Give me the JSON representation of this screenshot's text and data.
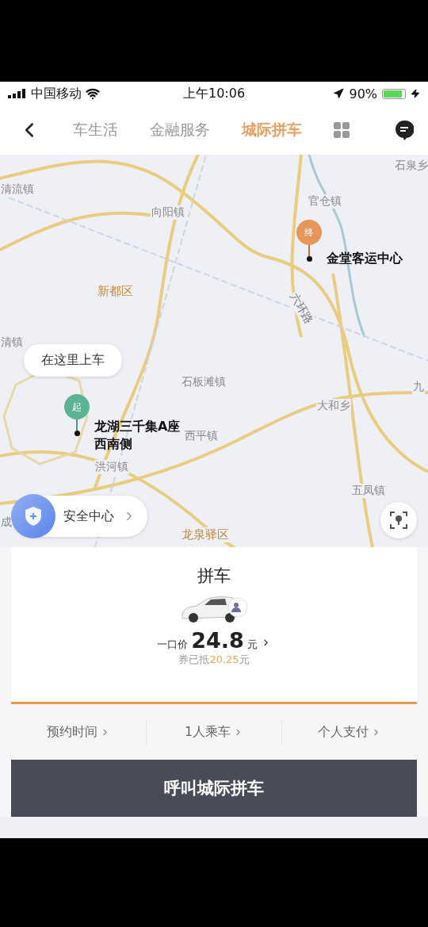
{
  "status_bar": {
    "carrier": "中国移动",
    "time": "上午10:06",
    "battery": "90%"
  },
  "nav": {
    "tabs": [
      {
        "label": "车生活",
        "selected": false
      },
      {
        "label": "金融服务",
        "selected": false
      },
      {
        "label": "城际拼车",
        "selected": true
      }
    ]
  },
  "map": {
    "labels": [
      {
        "text": "石泉乡",
        "kind": "place"
      },
      {
        "text": "清流镇",
        "kind": "place"
      },
      {
        "text": "官仓镇",
        "kind": "place"
      },
      {
        "text": "向阳镇",
        "kind": "place"
      },
      {
        "text": "新都区",
        "kind": "district"
      },
      {
        "text": "清镇",
        "kind": "place"
      },
      {
        "text": "石板滩镇",
        "kind": "place"
      },
      {
        "text": "大和乡",
        "kind": "place"
      },
      {
        "text": "九",
        "kind": "place"
      },
      {
        "text": "西平镇",
        "kind": "place"
      },
      {
        "text": "洪河镇",
        "kind": "place"
      },
      {
        "text": "五凤镇",
        "kind": "place"
      },
      {
        "text": "成",
        "kind": "place"
      },
      {
        "text": "龙泉驿区",
        "kind": "district"
      },
      {
        "text": "六环路",
        "kind": "road"
      }
    ],
    "destination": {
      "badge": "终",
      "name": "金堂客运中心"
    },
    "pickup": {
      "bubble": "在这里上车",
      "badge": "起",
      "name": "龙湖三千集A座西南侧"
    },
    "safety": {
      "label": "安全中心"
    }
  },
  "card": {
    "title": "拼车",
    "price_label": "一口价",
    "price": "24.8",
    "unit": "元",
    "discount_prefix": "券已抵",
    "discount_amount": "20.25",
    "discount_suffix": "元",
    "selected": true
  },
  "options": [
    {
      "label": "预约时间"
    },
    {
      "label": "1人乘车"
    },
    {
      "label": "个人支付"
    }
  ],
  "call_button": "呼叫城际拼车"
}
